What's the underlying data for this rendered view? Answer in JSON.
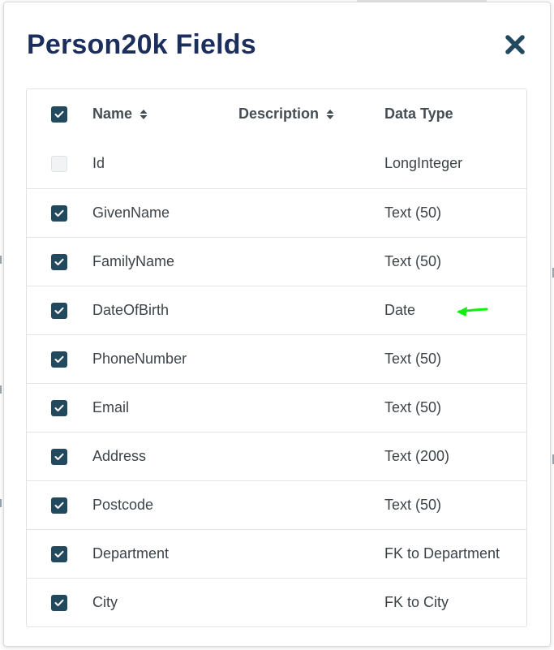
{
  "modal": {
    "title": "Person20k Fields"
  },
  "table": {
    "columns": [
      {
        "label": "Name",
        "sortable": true
      },
      {
        "label": "Description",
        "sortable": true
      },
      {
        "label": "Data Type",
        "sortable": false
      }
    ],
    "rows": [
      {
        "name": "Id",
        "description": "",
        "type": "LongInteger",
        "checked": true,
        "disabled": true
      },
      {
        "name": "GivenName",
        "description": "",
        "type": "Text (50)",
        "checked": true,
        "disabled": false
      },
      {
        "name": "FamilyName",
        "description": "",
        "type": "Text (50)",
        "checked": true,
        "disabled": false
      },
      {
        "name": "DateOfBirth",
        "description": "",
        "type": "Date",
        "checked": true,
        "disabled": false
      },
      {
        "name": "PhoneNumber",
        "description": "",
        "type": "Text (50)",
        "checked": true,
        "disabled": false
      },
      {
        "name": "Email",
        "description": "",
        "type": "Text (50)",
        "checked": true,
        "disabled": false
      },
      {
        "name": "Address",
        "description": "",
        "type": "Text (200)",
        "checked": true,
        "disabled": false
      },
      {
        "name": "Postcode",
        "description": "",
        "type": "Text (50)",
        "checked": true,
        "disabled": false
      },
      {
        "name": "Department",
        "description": "",
        "type": "FK to Department",
        "checked": true,
        "disabled": false
      },
      {
        "name": "City",
        "description": "",
        "type": "FK to City",
        "checked": true,
        "disabled": false
      }
    ]
  },
  "icons": {
    "close": "close-icon",
    "sort": "sort-icon",
    "check": "check-icon",
    "annotation": "arrow-left-icon"
  },
  "colors": {
    "title": "#1b2e5c",
    "accent": "#23495f",
    "annotation": "#11ee11"
  }
}
